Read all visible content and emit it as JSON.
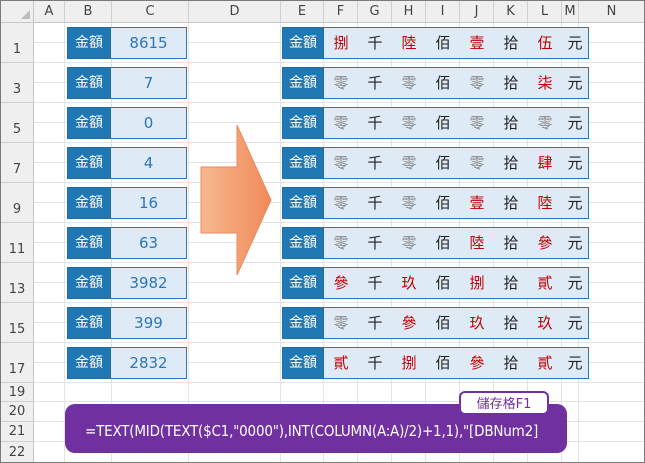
{
  "columns": [
    "A",
    "B",
    "C",
    "D",
    "E",
    "F",
    "G",
    "H",
    "I",
    "J",
    "K",
    "L",
    "M",
    "N"
  ],
  "rows": [
    "1",
    "3",
    "5",
    "7",
    "9",
    "11",
    "13",
    "15",
    "17",
    "19",
    "20",
    "21",
    "22"
  ],
  "label_text": "金額",
  "amounts": [
    "8615",
    "7",
    "0",
    "4",
    "16",
    "63",
    "3982",
    "399",
    "2832"
  ],
  "chinese_rows": [
    [
      "捌",
      "千",
      "陸",
      "佰",
      "壹",
      "拾",
      "伍",
      "元"
    ],
    [
      "零",
      "千",
      "零",
      "佰",
      "零",
      "拾",
      "柒",
      "元"
    ],
    [
      "零",
      "千",
      "零",
      "佰",
      "零",
      "拾",
      "零",
      "元"
    ],
    [
      "零",
      "千",
      "零",
      "佰",
      "零",
      "拾",
      "肆",
      "元"
    ],
    [
      "零",
      "千",
      "零",
      "佰",
      "壹",
      "拾",
      "陸",
      "元"
    ],
    [
      "零",
      "千",
      "零",
      "佰",
      "陸",
      "拾",
      "參",
      "元"
    ],
    [
      "參",
      "千",
      "玖",
      "佰",
      "捌",
      "拾",
      "貳",
      "元"
    ],
    [
      "零",
      "千",
      "參",
      "佰",
      "玖",
      "拾",
      "玖",
      "元"
    ],
    [
      "貳",
      "千",
      "捌",
      "佰",
      "參",
      "拾",
      "貳",
      "元"
    ]
  ],
  "colors": {
    "label_bg": "#1f78b4",
    "cell_bg": "#deebf6",
    "digit_red": "#c00000",
    "zero_gray": "#8a8a8a",
    "callout_purple": "#7030a0",
    "arrow_orange": "#f4a582"
  },
  "icons": {
    "arrow": "right-arrow-icon"
  },
  "formula": "=TEXT(MID(TEXT($C1,\"0000\"),INT(COLUMN(A:A)/2)+1,1),\"[DBNum2]",
  "cell_badge": "儲存格F1"
}
